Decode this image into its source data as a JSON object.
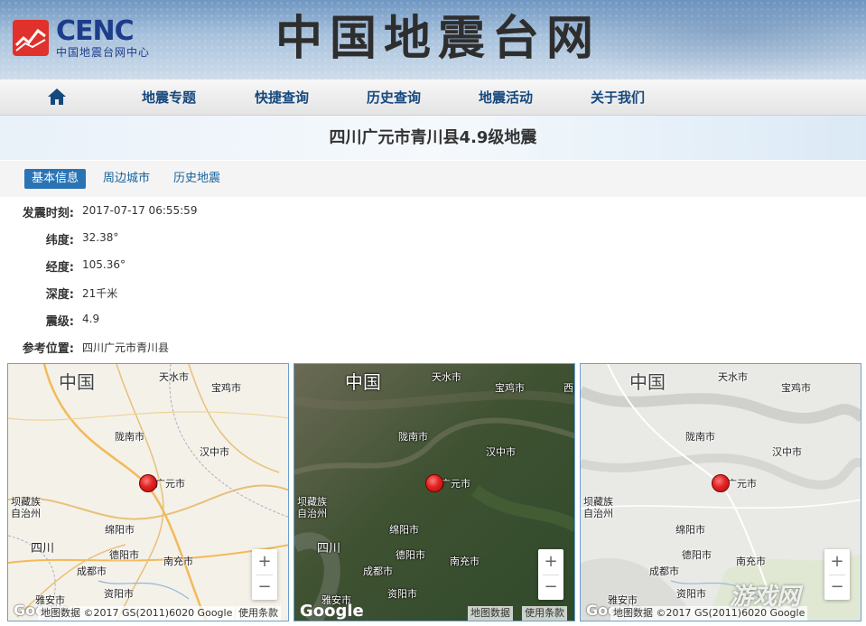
{
  "header": {
    "logo_text": "CENC",
    "logo_subtitle": "中国地震台网中心",
    "site_title": "中国地震台网",
    "brand_color": "#1d3c8a",
    "logo_color": "#e0312c"
  },
  "nav": {
    "home_icon": "home-icon",
    "items": [
      {
        "label": "地震专题"
      },
      {
        "label": "快捷查询"
      },
      {
        "label": "历史查询"
      },
      {
        "label": "地震活动"
      },
      {
        "label": "关于我们"
      }
    ]
  },
  "event": {
    "title": "四川广元市青川县4.9级地震"
  },
  "tabs": {
    "items": [
      {
        "label": "基本信息",
        "active": true
      },
      {
        "label": "周边城市",
        "active": false
      },
      {
        "label": "历史地震",
        "active": false
      }
    ],
    "active_color": "#2a74b6"
  },
  "info": {
    "rows": [
      {
        "label": "发震时刻:",
        "value": "2017-07-17 06:55:59"
      },
      {
        "label": "纬度:",
        "value": "32.38°"
      },
      {
        "label": "经度:",
        "value": "105.36°"
      },
      {
        "label": "深度:",
        "value": "21千米"
      },
      {
        "label": "震级:",
        "value": "4.9"
      },
      {
        "label": "参考位置:",
        "value": "四川广元市青川县"
      }
    ]
  },
  "maps": [
    {
      "variant": "roadmap",
      "places": [
        "中国",
        "天水市",
        "宝鸡市",
        "陇南市",
        "汉中市",
        "广元市",
        "坝藏族",
        "自治州",
        "绵阳市",
        "四川",
        "德阳市",
        "南充市",
        "成都市",
        "资阳市",
        "雅安市"
      ],
      "zoom_in": "+",
      "zoom_out": "−",
      "google": "Google",
      "attribution": "地图数据 ©2017 GS(2011)6020 Google",
      "terms": "使用条款"
    },
    {
      "variant": "satellite",
      "places": [
        "中国",
        "天水市",
        "宝鸡市",
        "西",
        "陇南市",
        "汉中市",
        "广元市",
        "坝藏族",
        "自治州",
        "绵阳市",
        "四川",
        "德阳市",
        "南充市",
        "成都市",
        "资阳市",
        "雅安市"
      ],
      "zoom_in": "+",
      "zoom_out": "−",
      "google": "Google",
      "attribution": "地图数据",
      "terms": "使用条款"
    },
    {
      "variant": "terrain",
      "places": [
        "中国",
        "天水市",
        "宝鸡市",
        "陇南市",
        "汉中市",
        "广元市",
        "坝藏族",
        "自治州",
        "绵阳市",
        "德阳市",
        "南充市",
        "成都市",
        "资阳市",
        "雅安市"
      ],
      "zoom_in": "+",
      "zoom_out": "−",
      "google": "Google",
      "attribution": "地图数据 ©2017 GS(2011)6020 Google",
      "terms": "使用条款"
    }
  ],
  "watermark": "游戏网"
}
